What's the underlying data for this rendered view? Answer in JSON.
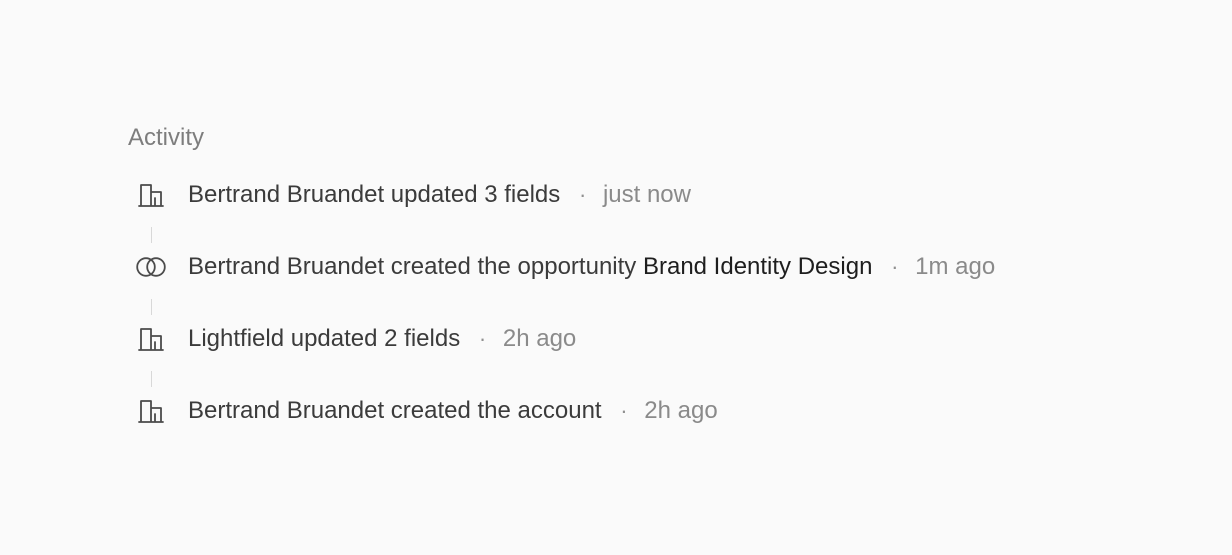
{
  "activity": {
    "title": "Activity",
    "items": [
      {
        "icon": "building-icon",
        "text": "Bertrand Bruandet updated 3 fields",
        "separator": "·",
        "time": "just now"
      },
      {
        "icon": "opportunity-rings-icon",
        "text": "Bertrand Bruandet created the opportunity",
        "link": "Brand Identity Design",
        "separator": "·",
        "time": "1m ago"
      },
      {
        "icon": "building-icon",
        "text": "Lightfield updated 2 fields",
        "separator": "·",
        "time": "2h ago"
      },
      {
        "icon": "building-icon",
        "text": "Bertrand Bruandet created the account",
        "separator": "·",
        "time": "2h ago"
      }
    ]
  }
}
